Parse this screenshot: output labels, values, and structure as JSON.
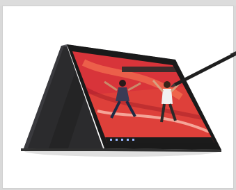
{
  "image": {
    "subject": "laptop-tent-mode-with-stylus",
    "colors": {
      "page_background": "#d9d9d9",
      "card_background": "#ffffff",
      "laptop_body": "#2b2b2d",
      "bezel": "#1a1a1a",
      "screen_red": "#d8343a",
      "screen_orange": "#f06a3a",
      "pen": "#1f1f1f"
    },
    "screen": {
      "has_taskbar": true,
      "has_window_bar": true,
      "has_people_photo": true
    }
  }
}
